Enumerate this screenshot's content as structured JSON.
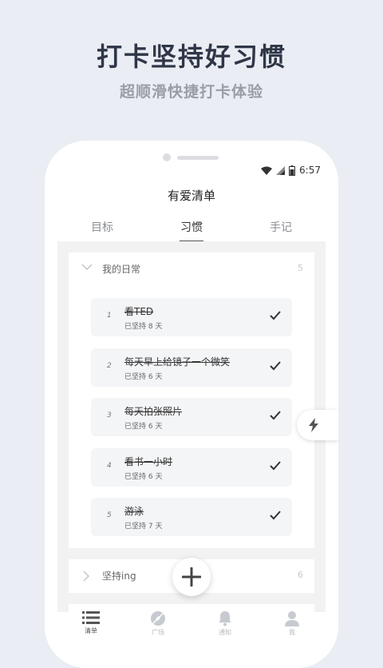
{
  "promo": {
    "title": "打卡坚持好习惯",
    "subtitle": "超顺滑快捷打卡体验"
  },
  "status_bar": {
    "time": "6:57"
  },
  "app": {
    "title": "有爱清单"
  },
  "tabs": [
    {
      "label": "目标"
    },
    {
      "label": "习惯"
    },
    {
      "label": "手记"
    }
  ],
  "groups": [
    {
      "name": "我的日常",
      "count": "5",
      "habits": [
        {
          "index": "1",
          "name": "看TED",
          "streak": "已坚持 8 天"
        },
        {
          "index": "2",
          "name": "每天早上给镜子一个微笑",
          "streak": "已坚持 6 天"
        },
        {
          "index": "3",
          "name": "每天拍张照片",
          "streak": "已坚持 6 天"
        },
        {
          "index": "4",
          "name": "看书一小时",
          "streak": "已坚持 6 天"
        },
        {
          "index": "5",
          "name": "游泳",
          "streak": "已坚持 7 天"
        }
      ]
    },
    {
      "name": "坚持ing",
      "count": "6"
    }
  ],
  "bottom_nav": [
    {
      "label": "清单",
      "icon": "list-icon"
    },
    {
      "label": "广场",
      "icon": "compass-icon"
    },
    {
      "label": "通知",
      "icon": "bell-icon"
    },
    {
      "label": "我",
      "icon": "person-icon"
    }
  ]
}
